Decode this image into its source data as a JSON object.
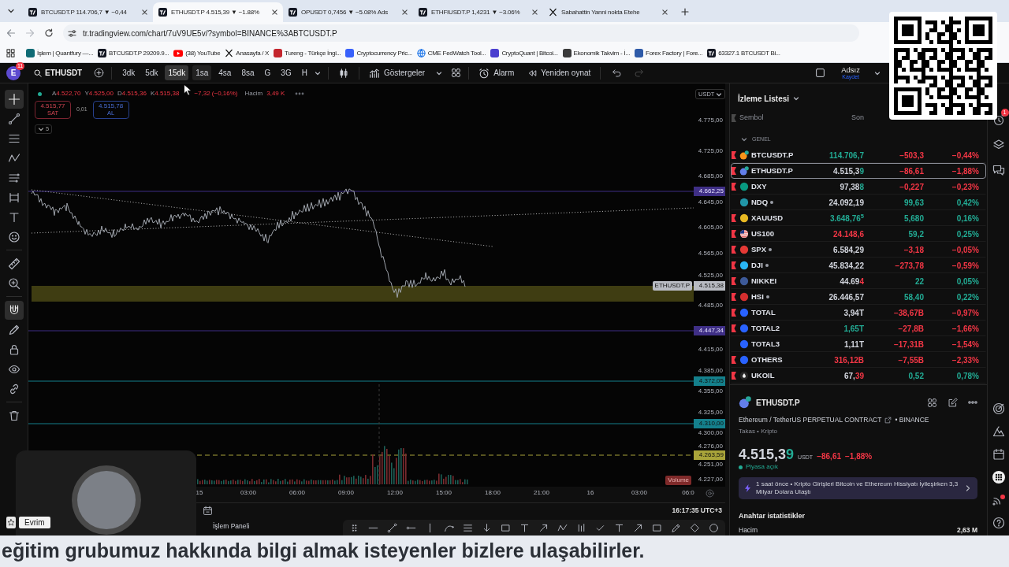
{
  "browser": {
    "tabs": [
      {
        "title": "BTCUSDT.P 114.706,7 ▼ −0,44",
        "kind": "chart",
        "selected": false
      },
      {
        "title": "ETHUSDT.P 4.515,39 ▼ −1.88%",
        "kind": "chart",
        "selected": true
      },
      {
        "title": "OPUSDT 0,7456 ▼ −5.08% Ads",
        "kind": "chart",
        "selected": false
      },
      {
        "title": "ETHFIUSDT.P 1,4231 ▼ −3.06%",
        "kind": "chart",
        "selected": false
      },
      {
        "title": "Sabahattin Yanni nokta Etehe",
        "kind": "x",
        "selected": false
      }
    ],
    "url": "tr.tradingview.com/chart/7uV9UE5v/?symbol=BINANCE%3ABTCUSDT.P",
    "bookmarks": [
      {
        "label": "İşlem | Quantfury —...",
        "kind": "badge",
        "color": "#0f6b75"
      },
      {
        "label": "BTCUSDT.P 29209.9...",
        "kind": "chart"
      },
      {
        "label": "(38) YouTube",
        "kind": "play"
      },
      {
        "label": "Anasayfa / X",
        "kind": "x"
      },
      {
        "label": "Tureng - Türkçe İngi...",
        "kind": "badge",
        "color": "#c4262e"
      },
      {
        "label": "Cryptocurrency Pric...",
        "kind": "badge",
        "color": "#3861fb"
      },
      {
        "label": "CME FedWatch Tool...",
        "kind": "globe"
      },
      {
        "label": "CryptoQuant | Bitcoi...",
        "kind": "badge",
        "color": "#4a3fcf"
      },
      {
        "label": "Ekonomik Takvim - İ...",
        "kind": "badge",
        "color": "#3a3a3a"
      },
      {
        "label": "Forex Factory | Fore...",
        "kind": "badge",
        "color": "#2e5aa8"
      },
      {
        "label": "63327.1 BTCUSDT Bi...",
        "kind": "chart"
      }
    ]
  },
  "toolbar": {
    "avatar": "E",
    "avatar_badge": "11",
    "symbol": "ETHUSDT",
    "intervals": [
      {
        "label": "3dk",
        "selected": false,
        "hovered": false
      },
      {
        "label": "5dk",
        "selected": false,
        "hovered": false
      },
      {
        "label": "15dk",
        "selected": true,
        "hovered": false
      },
      {
        "label": "1sa",
        "selected": false,
        "hovered": true
      },
      {
        "label": "4sa",
        "selected": false,
        "hovered": false
      },
      {
        "label": "8sa",
        "selected": false,
        "hovered": false
      },
      {
        "label": "G",
        "selected": false,
        "hovered": false
      },
      {
        "label": "3G",
        "selected": false,
        "hovered": false
      },
      {
        "label": "H",
        "selected": false,
        "hovered": false
      }
    ],
    "indicators": "Göstergeler",
    "alert": "Alarm",
    "replay": "Yeniden oynat",
    "history": [
      {
        "kind": "undo",
        "disabled": false
      },
      {
        "kind": "redo",
        "disabled": true
      }
    ],
    "layout_name": "Adsız",
    "save": "Kaydet"
  },
  "tool_groups": [
    {
      "tools": [
        {
          "kind": "crosshair",
          "selected": true
        },
        {
          "kind": "trend-line",
          "selected": false
        },
        {
          "kind": "fib-lines",
          "selected": false
        },
        {
          "kind": "zigzag",
          "selected": false
        },
        {
          "kind": "projection",
          "selected": false
        },
        {
          "kind": "brackets",
          "selected": false
        },
        {
          "kind": "text",
          "selected": false
        },
        {
          "kind": "smiley",
          "selected": false
        }
      ]
    },
    {
      "tools": [
        {
          "kind": "ruler",
          "selected": false
        },
        {
          "kind": "zoom",
          "selected": false
        }
      ]
    },
    {
      "tools": [
        {
          "kind": "magnet",
          "selected": true
        },
        {
          "kind": "pencil",
          "selected": false
        },
        {
          "kind": "lock",
          "selected": false
        },
        {
          "kind": "eye",
          "selected": false
        },
        {
          "kind": "link",
          "selected": false
        }
      ]
    },
    {
      "tools": [
        {
          "kind": "trash",
          "selected": false
        }
      ]
    }
  ],
  "chart": {
    "legend": {
      "live": true,
      "falling": true,
      "values": [
        {
          "label": "A",
          "value": "4.522,70"
        },
        {
          "label": "Y",
          "value": "4.525,00"
        },
        {
          "label": "D",
          "value": "4.515,36"
        },
        {
          "label": "K",
          "value": "4.515,38"
        }
      ],
      "change": "−7,32 (−0,16%)",
      "volume_label": "Hacim",
      "volume": "3,49 K"
    },
    "order": {
      "sell_price": "4.515,77",
      "sell_label": "SAT",
      "spread": "0,01",
      "buy_price": "4.515,78",
      "buy_label": "AL"
    },
    "indicator_count": "5",
    "currency": "USDT",
    "price_ticks": [
      "4.775,00",
      "4.725,00",
      "4.685,00",
      "4.645,00",
      "4.605,00",
      "4.565,00",
      "4.525,00",
      "4.485,00",
      "4.415,00",
      "4.385,00",
      "4.355,00",
      "4.325,00",
      "4.300,00",
      "4.276,00",
      "4.251,00",
      "4.227,00"
    ],
    "price_levels": [
      {
        "value": "4.662,25",
        "kind": "line",
        "color": "#3f2f86"
      },
      {
        "value": "4.515,38",
        "label": "ETHUSDT.P",
        "kind": "price",
        "color": "#b8bbc2"
      },
      {
        "value": "4.447,34",
        "kind": "line",
        "color": "#3f2f86"
      },
      {
        "value": "4.372,05",
        "kind": "line",
        "color": "#14808c"
      },
      {
        "value": "4.310,00",
        "kind": "line",
        "color": "#14808c"
      },
      {
        "value": "4.263,59",
        "kind": "dashed",
        "color": "#a9a43a"
      }
    ],
    "volume_badge": "Volume",
    "time_ticks": [
      "15",
      "03:00",
      "06:00",
      "09:00",
      "12:00",
      "15:00",
      "18:00",
      "21:00",
      "16",
      "03:00",
      "06:0"
    ],
    "clock": "16:17:35 UTC+3"
  },
  "watchlist": {
    "title": "İzleme Listesi",
    "columns": [
      "Sembol",
      "Son"
    ],
    "group": "GENEL",
    "group_expanded": true,
    "rows": [
      {
        "symbol": "BTCUSDT.P",
        "kind": "pair",
        "color": "#f7931a",
        "flagged": true,
        "market_dot": false,
        "selected": false,
        "last": [
          {
            "text": "114.706,7",
            "color": "#22ab94"
          }
        ],
        "change": "−503,3",
        "pct": "−0,44%",
        "falling": true
      },
      {
        "symbol": "ETHUSDT.P",
        "kind": "pair",
        "color": "#627eea",
        "flagged": true,
        "market_dot": false,
        "selected": true,
        "last": [
          {
            "text": "4.515,3"
          },
          {
            "text": "9",
            "color": "#22ab94"
          }
        ],
        "change": "−86,61",
        "pct": "−1,88%",
        "falling": true
      },
      {
        "symbol": "DXY",
        "kind": "circle",
        "color": "#089981",
        "flagged": true,
        "market_dot": false,
        "selected": false,
        "last": [
          {
            "text": "97,38"
          },
          {
            "text": "8",
            "color": "#22ab94"
          }
        ],
        "change": "−0,227",
        "pct": "−0,23%",
        "falling": true
      },
      {
        "symbol": "NDQ",
        "kind": "circle",
        "color": "#2196a8",
        "flagged": false,
        "market_dot": true,
        "selected": false,
        "last": [
          {
            "text": "24.092,19"
          }
        ],
        "change": "99,63",
        "pct": "0,42%",
        "falling": false
      },
      {
        "symbol": "XAUUSD",
        "kind": "circle",
        "color": "#e8b923",
        "flagged": true,
        "market_dot": false,
        "selected": false,
        "last": [
          {
            "text": "3.648,76$^{5}$",
            "color": "#22ab94"
          }
        ],
        "change": "5,680",
        "pct": "0,16%",
        "falling": false
      },
      {
        "symbol": "US100",
        "kind": "flag",
        "flagged": true,
        "market_dot": false,
        "selected": false,
        "last": [
          {
            "text": "24.148,6",
            "color": "#f23645"
          }
        ],
        "change": "59,2",
        "pct": "0,25%",
        "falling": false
      },
      {
        "symbol": "SPX",
        "kind": "circle",
        "color": "#e53935",
        "flagged": true,
        "market_dot": true,
        "selected": false,
        "last": [
          {
            "text": "6.584,29"
          }
        ],
        "change": "−3,18",
        "pct": "−0,05%",
        "falling": true
      },
      {
        "symbol": "DJI",
        "kind": "circle",
        "color": "#29b6f6",
        "flagged": true,
        "market_dot": true,
        "selected": false,
        "last": [
          {
            "text": "45.834,22"
          }
        ],
        "change": "−273,78",
        "pct": "−0,59%",
        "falling": true
      },
      {
        "symbol": "NIKKEI",
        "kind": "circle",
        "color": "#3d5a99",
        "flagged": true,
        "market_dot": false,
        "selected": false,
        "last": [
          {
            "text": "44.69"
          },
          {
            "text": "4",
            "color": "#f23645"
          }
        ],
        "change": "22",
        "pct": "0,05%",
        "falling": false
      },
      {
        "symbol": "HSI",
        "kind": "circle",
        "color": "#d32f2f",
        "flagged": true,
        "market_dot": true,
        "selected": false,
        "last": [
          {
            "text": "26.446,57"
          }
        ],
        "change": "58,40",
        "pct": "0,22%",
        "falling": false
      },
      {
        "symbol": "TOTAL",
        "kind": "circle",
        "color": "#2962ff",
        "flagged": true,
        "market_dot": false,
        "selected": false,
        "last": [
          {
            "text": "3,94T"
          }
        ],
        "change": "−38,67B",
        "pct": "−0,97%",
        "falling": true
      },
      {
        "symbol": "TOTAL2",
        "kind": "circle",
        "color": "#2962ff",
        "flagged": true,
        "market_dot": false,
        "selected": false,
        "last": [
          {
            "text": "1,65T",
            "color": "#22ab94"
          }
        ],
        "change": "−27,8B",
        "pct": "−1,66%",
        "falling": true
      },
      {
        "symbol": "TOTAL3",
        "kind": "circle",
        "color": "#2962ff",
        "flagged": false,
        "market_dot": false,
        "selected": false,
        "last": [
          {
            "text": "1,11T"
          }
        ],
        "change": "−17,31B",
        "pct": "−1,54%",
        "falling": true
      },
      {
        "symbol": "OTHERS",
        "kind": "circle",
        "color": "#2962ff",
        "flagged": true,
        "market_dot": false,
        "selected": false,
        "last": [
          {
            "text": "316,12B",
            "color": "#f23645"
          }
        ],
        "change": "−7,55B",
        "pct": "−2,33%",
        "falling": true
      },
      {
        "symbol": "UKOIL",
        "kind": "drop",
        "flagged": true,
        "market_dot": false,
        "selected": false,
        "last": [
          {
            "text": "67,"
          },
          {
            "text": "39",
            "color": "#f23645"
          }
        ],
        "change": "0,52",
        "pct": "0,78%",
        "falling": false
      }
    ]
  },
  "details": {
    "symbol": "ETHUSDT.P",
    "color": "#627eea",
    "description": "Ethereum / TetherUS PERPETUAL CONTRACT",
    "exchange": "• BINANCE",
    "meta": "Takas • Kripto",
    "price": [
      {
        "text": "4.515,3"
      },
      {
        "text": "9",
        "color": "#22ab94"
      }
    ],
    "currency": "USDT",
    "change": "−86,61",
    "pct": "−1,88%",
    "falling": true,
    "market_open": true,
    "market_status": "Piyasa açık",
    "news": "1 saat önce • Kripto Girişleri Bitcoin ve Ethereum Hissiyatı İyileşirken 3,3 Milyar Dolara Ulaştı",
    "stats_title": "Anahtar istatistikler",
    "stats": [
      {
        "label": "Hacim",
        "value": "2,63 M"
      }
    ]
  },
  "sidebar": {
    "top": [
      {
        "kind": "alerts",
        "badge": "1"
      },
      {
        "kind": "layers"
      },
      {
        "kind": "chat"
      }
    ],
    "bottom": [
      {
        "kind": "target"
      },
      {
        "kind": "ideas"
      },
      {
        "kind": "calendar"
      },
      {
        "kind": "apps"
      },
      {
        "kind": "broadcast",
        "notification": true
      },
      {
        "kind": "help"
      }
    ]
  },
  "bottom_bar": {
    "panel": "İşlem Paneli",
    "tools": [
      {
        "kind": "handle"
      },
      {
        "kind": "horizontal-line"
      },
      {
        "kind": "trend-line"
      },
      {
        "kind": "horizontal-ray"
      },
      {
        "kind": "vertical-line"
      },
      {
        "kind": "curve"
      },
      {
        "kind": "fib-lines"
      },
      {
        "kind": "arrow-down"
      },
      {
        "kind": "rectangle"
      },
      {
        "kind": "text"
      },
      {
        "kind": "arrow"
      },
      {
        "kind": "zigzag"
      },
      {
        "kind": "bars"
      },
      {
        "kind": "check"
      },
      {
        "kind": "text"
      },
      {
        "kind": "arrow"
      },
      {
        "kind": "rectangle"
      },
      {
        "kind": "pencil"
      },
      {
        "kind": "diamond"
      },
      {
        "kind": "circle"
      }
    ]
  },
  "presenter": {
    "name": "Evrim"
  },
  "subtitle": "eğitim grubumuz hakkında bilgi almak isteyenler bizlere ulaşabilirler."
}
